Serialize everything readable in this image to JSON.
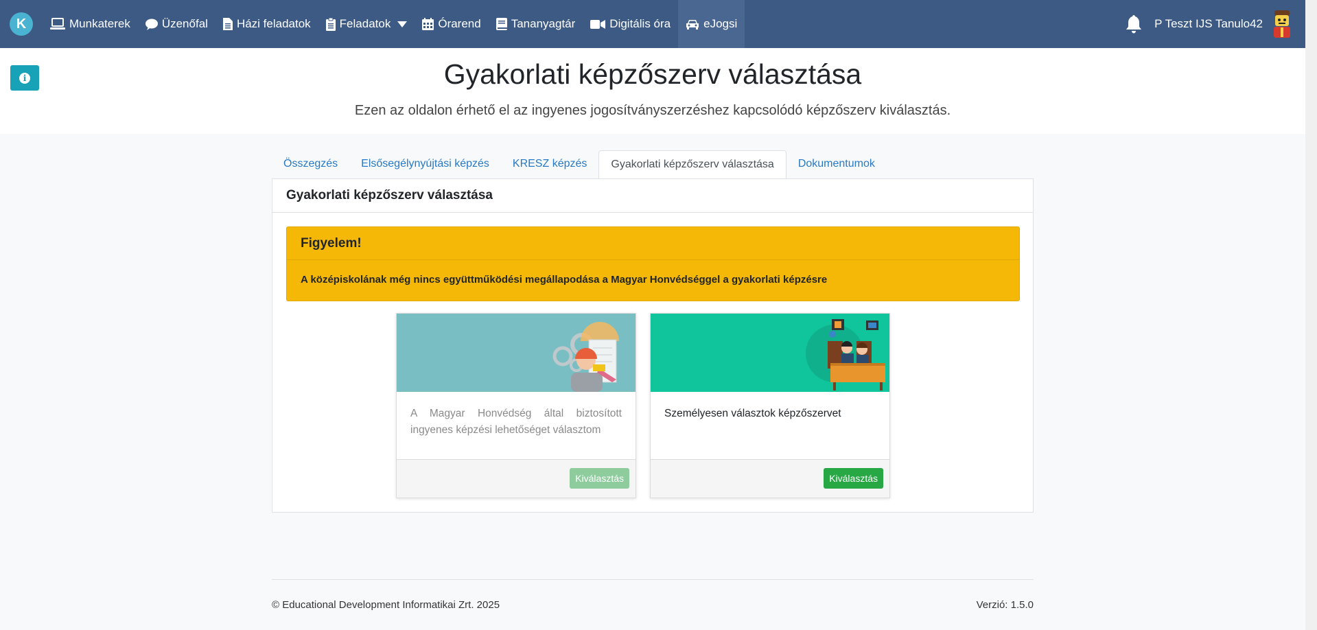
{
  "navbar": {
    "logo_letter": "K",
    "items": [
      {
        "label": "Munkaterek",
        "icon": "laptop-icon"
      },
      {
        "label": "Üzenőfal",
        "icon": "comment-icon"
      },
      {
        "label": "Házi feladatok",
        "icon": "file-icon"
      },
      {
        "label": "Feladatok",
        "icon": "clipboard-icon"
      },
      {
        "label": "Órarend",
        "icon": "calendar-icon"
      },
      {
        "label": "Tananyagtár",
        "icon": "book-icon"
      },
      {
        "label": "Digitális óra",
        "icon": "video-icon"
      },
      {
        "label": "eJogsi",
        "icon": "car-icon"
      }
    ],
    "user_name": "P Teszt IJS Tanulo42",
    "colors": {
      "bar": "#3c5a84",
      "active": "#4a6791"
    }
  },
  "header": {
    "title": "Gyakorlati képzőszerv választása",
    "subtitle": "Ezen az oldalon érhető el az ingyenes jogosítványszerzéshez kapcsolódó képzőszerv kiválasztás."
  },
  "tabs": [
    {
      "label": "Összegzés"
    },
    {
      "label": "Elsősegélynyújtási képzés"
    },
    {
      "label": "KRESZ képzés"
    },
    {
      "label": "Gyakorlati képzőszerv választása",
      "active": true
    },
    {
      "label": "Dokumentumok"
    }
  ],
  "panel": {
    "title": "Gyakorlati képzőszerv választása",
    "alert": {
      "title": "Figyelem!",
      "message": "A középiskolának még nincs együttműködési megállapodása a Magyar Honvédséggel a gyakorlati képzésre",
      "color": "#f6b806"
    },
    "cards": [
      {
        "text": "A Magyar Honvédség által biztosított ingyenes képzési lehetőséget választom",
        "button": "Kiválasztás",
        "disabled": true,
        "image_color": "#79bec3"
      },
      {
        "text": "Személyesen választok képzőszervet",
        "button": "Kiválasztás",
        "disabled": false,
        "image_color": "#10c49b"
      }
    ]
  },
  "footer": {
    "copyright": "© Educational Development Informatikai Zrt. 2025",
    "version": "Verzió: 1.5.0"
  }
}
